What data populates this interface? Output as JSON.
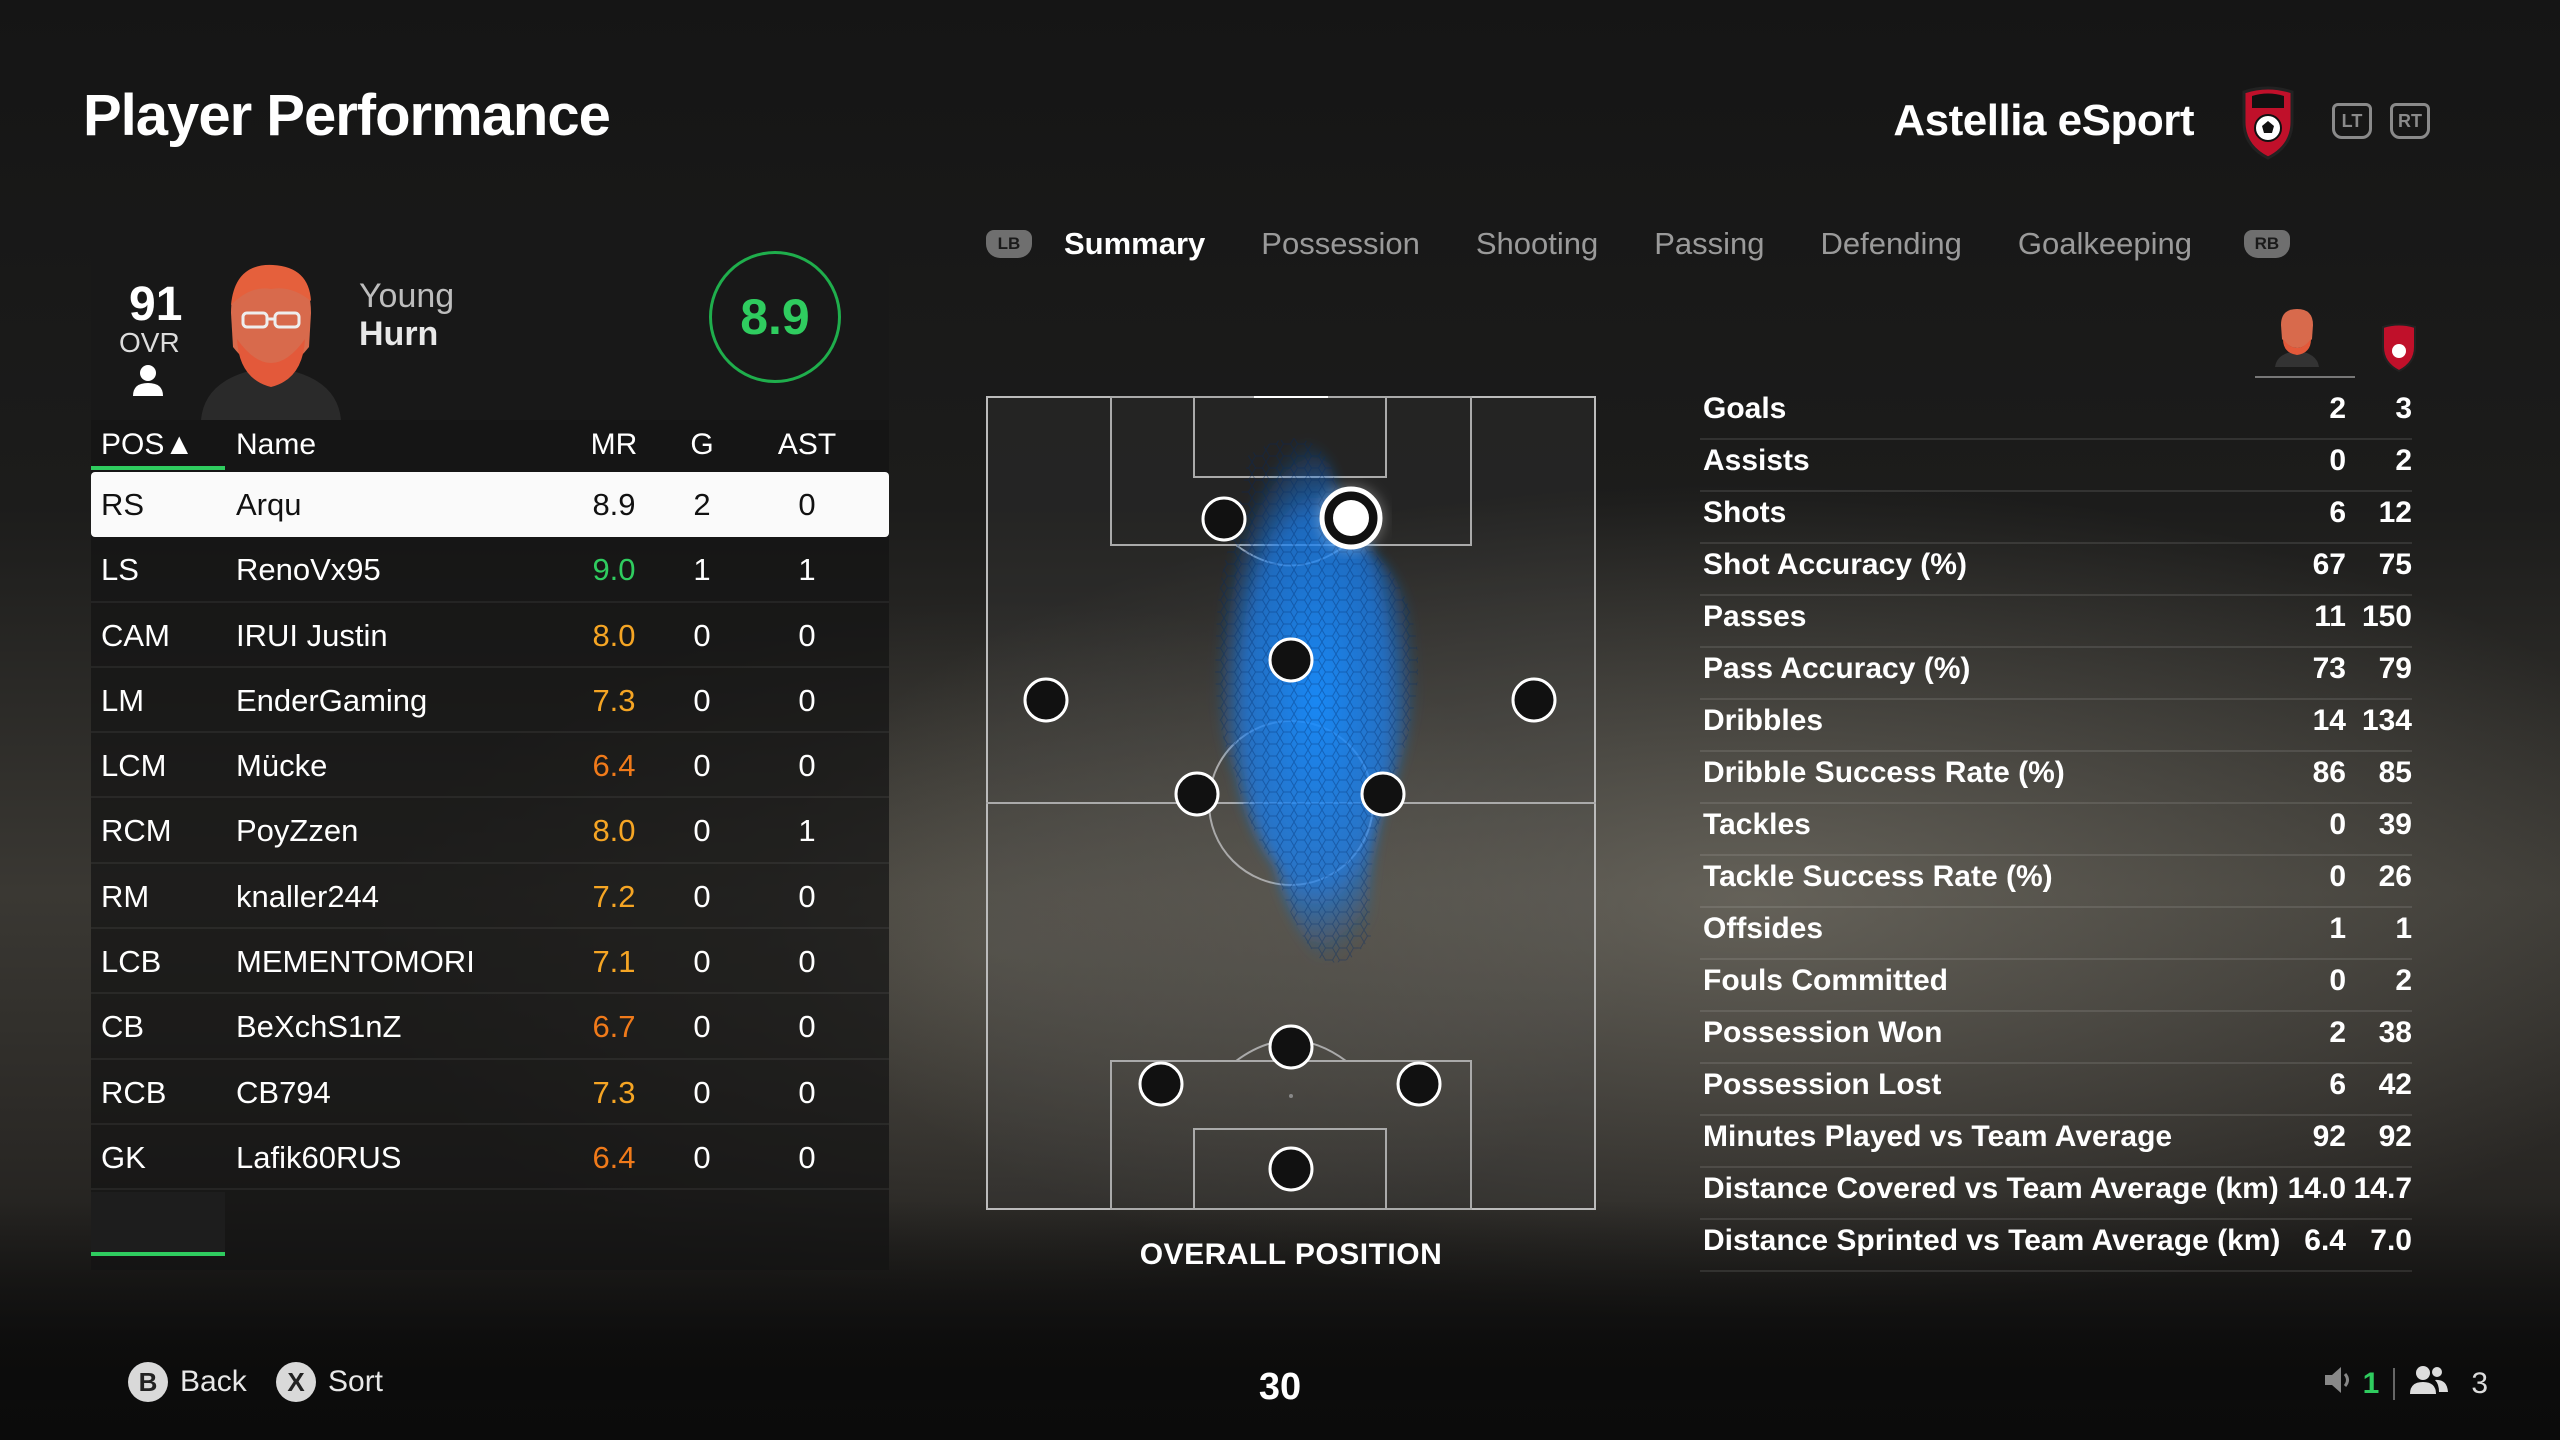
{
  "header": {
    "title": "Player Performance",
    "team_name": "Astellia eSport",
    "lt": "LT",
    "rt": "RT"
  },
  "player": {
    "ovr": "91",
    "ovr_label": "OVR",
    "first_name": "Young",
    "last_name": "Hurn",
    "rating": "8.9"
  },
  "table": {
    "headers": {
      "pos": "POS▲",
      "name": "Name",
      "mr": "MR",
      "g": "G",
      "ast": "AST"
    },
    "rows": [
      {
        "pos": "RS",
        "name": "Arqu",
        "mr": "8.9",
        "g": "2",
        "ast": "0",
        "mr_color": "#111111"
      },
      {
        "pos": "LS",
        "name": "RenoVx95",
        "mr": "9.0",
        "g": "1",
        "ast": "1",
        "mr_color": "#2fcc5f"
      },
      {
        "pos": "CAM",
        "name": "IRUI Justin",
        "mr": "8.0",
        "g": "0",
        "ast": "0",
        "mr_color": "#f5a524"
      },
      {
        "pos": "LM",
        "name": "EnderGaming",
        "mr": "7.3",
        "g": "0",
        "ast": "0",
        "mr_color": "#f5a524"
      },
      {
        "pos": "LCM",
        "name": "Mücke",
        "mr": "6.4",
        "g": "0",
        "ast": "0",
        "mr_color": "#f07a1a"
      },
      {
        "pos": "RCM",
        "name": "PoyZzen",
        "mr": "8.0",
        "g": "0",
        "ast": "1",
        "mr_color": "#f5a524"
      },
      {
        "pos": "RM",
        "name": "knaller244",
        "mr": "7.2",
        "g": "0",
        "ast": "0",
        "mr_color": "#f5a524"
      },
      {
        "pos": "LCB",
        "name": "MEMENTOMORI",
        "mr": "7.1",
        "g": "0",
        "ast": "0",
        "mr_color": "#f5a524"
      },
      {
        "pos": "CB",
        "name": "BeXchS1nZ",
        "mr": "6.7",
        "g": "0",
        "ast": "0",
        "mr_color": "#f07a1a"
      },
      {
        "pos": "RCB",
        "name": "CB794",
        "mr": "7.3",
        "g": "0",
        "ast": "0",
        "mr_color": "#f5a524"
      },
      {
        "pos": "GK",
        "name": "Lafik60RUS",
        "mr": "6.4",
        "g": "0",
        "ast": "0",
        "mr_color": "#f07a1a"
      }
    ]
  },
  "tabs": {
    "lb": "LB",
    "rb": "RB",
    "items": [
      "Summary",
      "Possession",
      "Shooting",
      "Passing",
      "Defending",
      "Goalkeeping"
    ],
    "active": "Summary"
  },
  "pitch": {
    "label": "OVERALL POSITION"
  },
  "stats": [
    {
      "label": "Goals",
      "player": "2",
      "team": "3"
    },
    {
      "label": "Assists",
      "player": "0",
      "team": "2"
    },
    {
      "label": "Shots",
      "player": "6",
      "team": "12"
    },
    {
      "label": "Shot Accuracy (%)",
      "player": "67",
      "team": "75"
    },
    {
      "label": "Passes",
      "player": "11",
      "team": "150"
    },
    {
      "label": "Pass Accuracy (%)",
      "player": "73",
      "team": "79"
    },
    {
      "label": "Dribbles",
      "player": "14",
      "team": "134"
    },
    {
      "label": "Dribble Success Rate (%)",
      "player": "86",
      "team": "85"
    },
    {
      "label": "Tackles",
      "player": "0",
      "team": "39"
    },
    {
      "label": "Tackle Success Rate (%)",
      "player": "0",
      "team": "26"
    },
    {
      "label": "Offsides",
      "player": "1",
      "team": "1"
    },
    {
      "label": "Fouls Committed",
      "player": "0",
      "team": "2"
    },
    {
      "label": "Possession Won",
      "player": "2",
      "team": "38"
    },
    {
      "label": "Possession Lost",
      "player": "6",
      "team": "42"
    },
    {
      "label": "Minutes Played vs Team Average",
      "player": "92",
      "team": "92"
    },
    {
      "label": "Distance Covered vs Team Average (km)",
      "player": "14.0",
      "team": "14.7"
    },
    {
      "label": "Distance Sprinted vs Team Average (km)",
      "player": "6.4",
      "team": "7.0"
    }
  ],
  "footer": {
    "back_key": "B",
    "back_label": "Back",
    "sort_key": "X",
    "sort_label": "Sort",
    "timer": "30",
    "ready_count": "1",
    "players_count": "3"
  },
  "colors": {
    "accent": "#2fcc5f",
    "heatmap": "#1a8cff"
  },
  "icons": [
    "person-icon",
    "team-crest-icon",
    "speaker-icon",
    "group-icon",
    "player-avatar"
  ]
}
